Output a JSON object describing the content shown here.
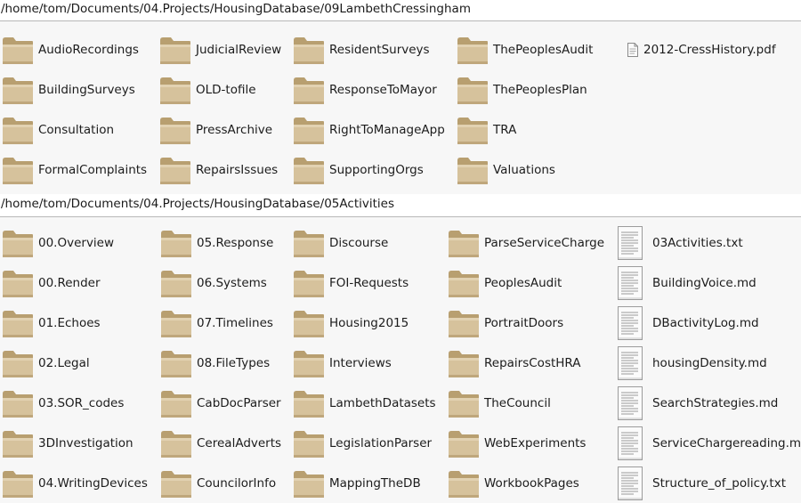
{
  "section1": {
    "path": "/home/tom/Documents/04.Projects/HousingDatabase/09LambethCressingham",
    "columns": [
      [
        {
          "name": "AudioRecordings",
          "type": "folder"
        },
        {
          "name": "BuildingSurveys",
          "type": "folder"
        },
        {
          "name": "Consultation",
          "type": "folder"
        },
        {
          "name": "FormalComplaints",
          "type": "folder"
        }
      ],
      [
        {
          "name": "JudicialReview",
          "type": "folder"
        },
        {
          "name": "OLD-tofile",
          "type": "folder"
        },
        {
          "name": "PressArchive",
          "type": "folder"
        },
        {
          "name": "RepairsIssues",
          "type": "folder"
        }
      ],
      [
        {
          "name": "ResidentSurveys",
          "type": "folder"
        },
        {
          "name": "ResponseToMayor",
          "type": "folder"
        },
        {
          "name": "RightToManageApp",
          "type": "folder"
        },
        {
          "name": "SupportingOrgs",
          "type": "folder"
        }
      ],
      [
        {
          "name": "ThePeoplesAudit",
          "type": "folder"
        },
        {
          "name": "ThePeoplesPlan",
          "type": "folder"
        },
        {
          "name": "TRA",
          "type": "folder"
        },
        {
          "name": "Valuations",
          "type": "folder"
        }
      ],
      [
        {
          "name": "2012-CressHistory.pdf",
          "type": "pdf"
        }
      ]
    ]
  },
  "section2": {
    "path": "/home/tom/Documents/04.Projects/HousingDatabase/05Activities",
    "columns": [
      [
        {
          "name": "00.Overview",
          "type": "folder"
        },
        {
          "name": "00.Render",
          "type": "folder"
        },
        {
          "name": "01.Echoes",
          "type": "folder"
        },
        {
          "name": "02.Legal",
          "type": "folder"
        },
        {
          "name": "03.SOR_codes",
          "type": "folder"
        },
        {
          "name": "3DInvestigation",
          "type": "folder"
        },
        {
          "name": "04.WritingDevices",
          "type": "folder"
        }
      ],
      [
        {
          "name": "05.Response",
          "type": "folder"
        },
        {
          "name": "06.Systems",
          "type": "folder"
        },
        {
          "name": "07.Timelines",
          "type": "folder"
        },
        {
          "name": "08.FileTypes",
          "type": "folder"
        },
        {
          "name": "CabDocParser",
          "type": "folder"
        },
        {
          "name": "CerealAdverts",
          "type": "folder"
        },
        {
          "name": "CouncilorInfo",
          "type": "folder"
        }
      ],
      [
        {
          "name": "Discourse",
          "type": "folder"
        },
        {
          "name": "FOI-Requests",
          "type": "folder"
        },
        {
          "name": "Housing2015",
          "type": "folder"
        },
        {
          "name": "Interviews",
          "type": "folder"
        },
        {
          "name": "LambethDatasets",
          "type": "folder"
        },
        {
          "name": "LegislationParser",
          "type": "folder"
        },
        {
          "name": "MappingTheDB",
          "type": "folder"
        }
      ],
      [
        {
          "name": "ParseServiceCharge",
          "type": "folder"
        },
        {
          "name": "PeoplesAudit",
          "type": "folder"
        },
        {
          "name": "PortraitDoors",
          "type": "folder"
        },
        {
          "name": "RepairsCostHRA",
          "type": "folder"
        },
        {
          "name": "TheCouncil",
          "type": "folder"
        },
        {
          "name": "WebExperiments",
          "type": "folder"
        },
        {
          "name": "WorkbookPages",
          "type": "folder"
        }
      ],
      [
        {
          "name": "03Activities.txt",
          "type": "text"
        },
        {
          "name": "BuildingVoice.md",
          "type": "text"
        },
        {
          "name": "DBactivityLog.md",
          "type": "text"
        },
        {
          "name": "housingDensity.md",
          "type": "text"
        },
        {
          "name": "SearchStrategies.md",
          "type": "text"
        },
        {
          "name": "ServiceChargereading.md",
          "type": "text"
        },
        {
          "name": "Structure_of_policy.txt",
          "type": "text"
        }
      ]
    ]
  },
  "icons": {
    "folder": "folder-icon",
    "pdf": "pdf-file-icon",
    "text": "text-file-icon"
  },
  "colors": {
    "folder_body": "#d2bd95",
    "folder_tab": "#bba477",
    "pane_bg": "#f7f7f7",
    "separator": "#b8b8b8"
  }
}
